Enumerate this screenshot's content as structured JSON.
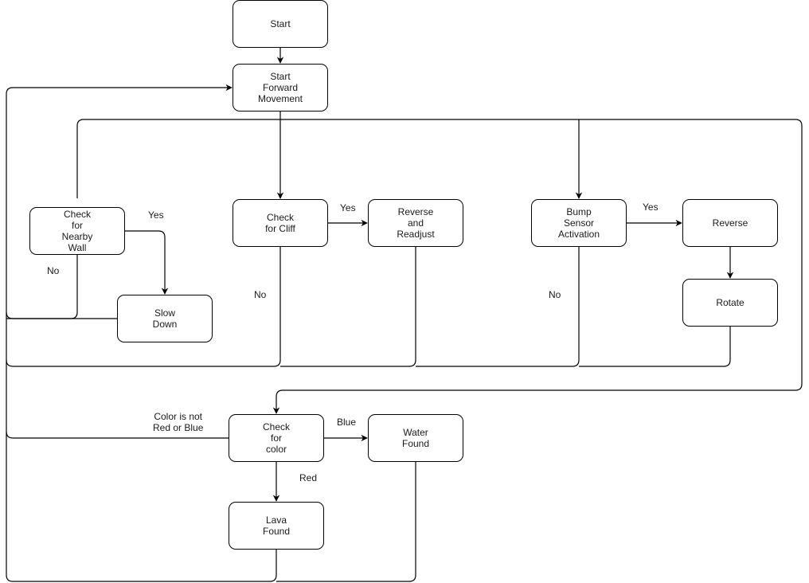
{
  "diagram": {
    "type": "flowchart",
    "nodes": {
      "start": "Start",
      "forward": "Start\nForward\nMovement",
      "wall": "Check\nfor\nNearby\nWall",
      "slow": "Slow\nDown",
      "cliff": "Check\nfor Cliff",
      "readjust": "Reverse\nand\nReadjust",
      "bump": "Bump\nSensor\nActivation",
      "reverse": "Reverse",
      "rotate": "Rotate",
      "color": "Check\nfor\ncolor",
      "water": "Water\nFound",
      "lava": "Lava\nFound"
    },
    "edge_labels": {
      "wall_yes": "Yes",
      "wall_no": "No",
      "cliff_yes": "Yes",
      "cliff_no": "No",
      "bump_yes": "Yes",
      "bump_no": "No",
      "color_blue": "Blue",
      "color_red": "Red",
      "color_other": "Color is not\nRed or Blue"
    },
    "edges": [
      {
        "from": "start",
        "to": "forward"
      },
      {
        "from": "forward",
        "to": "wall"
      },
      {
        "from": "forward",
        "to": "cliff"
      },
      {
        "from": "forward",
        "to": "bump"
      },
      {
        "from": "forward",
        "to": "color"
      },
      {
        "from": "wall",
        "to": "slow",
        "label": "Yes"
      },
      {
        "from": "wall",
        "to": "forward",
        "label": "No"
      },
      {
        "from": "slow",
        "to": "forward"
      },
      {
        "from": "cliff",
        "to": "readjust",
        "label": "Yes"
      },
      {
        "from": "cliff",
        "to": "forward",
        "label": "No"
      },
      {
        "from": "readjust",
        "to": "forward"
      },
      {
        "from": "bump",
        "to": "reverse",
        "label": "Yes"
      },
      {
        "from": "bump",
        "to": "forward",
        "label": "No"
      },
      {
        "from": "reverse",
        "to": "rotate"
      },
      {
        "from": "rotate",
        "to": "forward"
      },
      {
        "from": "color",
        "to": "water",
        "label": "Blue"
      },
      {
        "from": "color",
        "to": "lava",
        "label": "Red"
      },
      {
        "from": "color",
        "to": "forward",
        "label": "Color is not Red or Blue"
      },
      {
        "from": "water",
        "to": "forward"
      },
      {
        "from": "lava",
        "to": "forward"
      }
    ]
  }
}
